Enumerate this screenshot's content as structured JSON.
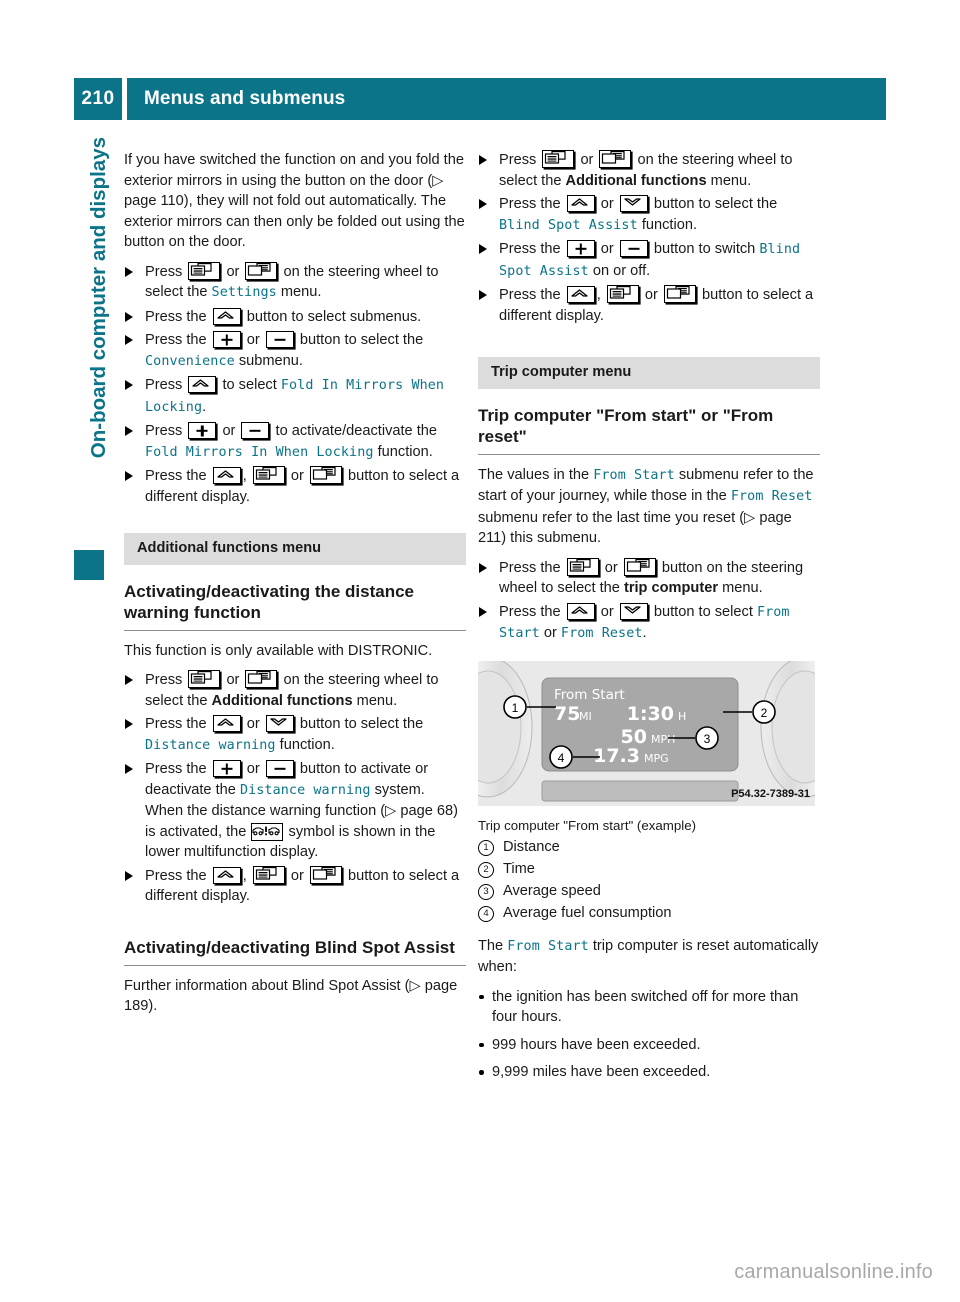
{
  "header": {
    "page_number": "210",
    "title": "Menus and submenus",
    "accent_color": "#0b7489"
  },
  "sidetab": {
    "chapter": "On-board computer and displays"
  },
  "left_column": {
    "intro_paragraph": "If you have switched the function on and you fold the exterior mirrors in using the button on the door (▷ page 110), they will not fold out automatically. The exterior mirrors can then only be folded out using the button on the door.",
    "steps": [
      {
        "pre": "Press",
        "icons": [
          "display-left-icon",
          "display-right-icon"
        ],
        "joiner": "or",
        "mid": "on the steering wheel to select the",
        "mono": "Settings",
        "post": "menu."
      },
      {
        "pre": "Press the",
        "icons": [
          "chevron-up-icon"
        ],
        "post": "button to select submenus."
      },
      {
        "pre": "Press the",
        "icons": [
          "plus-icon",
          "minus-icon"
        ],
        "joiner": "or",
        "mid": "button to select the",
        "mono": "Convenience",
        "post": "submenu."
      },
      {
        "pre": "Press",
        "icons": [
          "chevron-up-icon"
        ],
        "mid": "to select",
        "mono": "Fold In Mirrors When Locking",
        "post": "."
      },
      {
        "pre": "Press",
        "icons": [
          "plus-icon",
          "minus-icon"
        ],
        "joiner": "or",
        "mid": "to activate/deactivate the",
        "mono": "Fold Mirrors In When Locking",
        "post": "function."
      },
      {
        "pre": "Press the",
        "icons": [
          "chevron-up-icon",
          "display-left-icon",
          "display-right-icon"
        ],
        "post": "button to select a different display."
      }
    ],
    "band_heading": "Additional functions menu",
    "subhead_distance": "Activating/deactivating the distance warning function",
    "distance_intro": "This function is only available with DISTRONIC.",
    "distance_steps": [
      {
        "pre": "Press",
        "icons": [
          "display-left-icon",
          "display-right-icon"
        ],
        "joiner": "or",
        "mid": "on the steering wheel to select the",
        "bold": "Additional functions",
        "post": "menu."
      },
      {
        "pre": "Press the",
        "icons": [
          "chevron-up-icon",
          "chevron-down-icon"
        ],
        "joiner": "or",
        "mid": "button to select the",
        "mono": "Distance warning",
        "post": "function."
      },
      {
        "pre": "Press the",
        "icons": [
          "plus-icon",
          "minus-icon"
        ],
        "joiner": "or",
        "mid": "button to activate or deactivate the",
        "mono": "Distance warning",
        "post": "system.",
        "extra_pre": "When the distance warning function (▷ page 68) is activated, the",
        "extra_icon": "distance-warning-symbol",
        "extra_post": "symbol is shown in the lower multifunction display."
      },
      {
        "pre": "Press the",
        "icons": [
          "chevron-up-icon",
          "display-left-icon",
          "display-right-icon"
        ],
        "post": "button to select a different display."
      }
    ],
    "subhead_blindspot": "Activating/deactivating Blind Spot Assist",
    "blindspot_intro": "Further information about Blind Spot Assist (▷ page 189)."
  },
  "right_column": {
    "blindspot_steps": [
      {
        "pre": "Press",
        "icons": [
          "display-left-icon",
          "display-right-icon"
        ],
        "joiner": "or",
        "mid": "on the steering wheel to select the",
        "bold": "Additional functions",
        "post": "menu."
      },
      {
        "pre": "Press the",
        "icons": [
          "chevron-up-icon",
          "chevron-down-icon"
        ],
        "joiner": "or",
        "mid": "button to select the",
        "mono": "Blind Spot Assist",
        "post": "function."
      },
      {
        "pre": "Press the",
        "icons": [
          "plus-icon",
          "minus-icon"
        ],
        "joiner": "or",
        "mid": "button to switch",
        "mono": "Blind Spot Assist",
        "post": "on or off."
      },
      {
        "pre": "Press the",
        "icons": [
          "chevron-up-icon",
          "display-left-icon",
          "display-right-icon"
        ],
        "post": "button to select a different display."
      }
    ],
    "band_heading": "Trip computer menu",
    "subhead_trip": "Trip computer \"From start\" or \"From reset\"",
    "trip_intro_1": "The values in the ",
    "trip_mono_1": "From Start",
    "trip_intro_2": " submenu refer to the start of your journey, while those in the ",
    "trip_mono_2": "From Reset",
    "trip_intro_3": " submenu refer to the last time you reset (▷ page 211) this submenu.",
    "trip_steps": [
      {
        "pre": "Press the",
        "icons": [
          "display-left-icon",
          "display-right-icon"
        ],
        "joiner": "or",
        "mid": "button on the steering wheel to select the",
        "bold": "trip computer",
        "post": "menu."
      },
      {
        "pre": "Press the",
        "icons": [
          "chevron-up-icon",
          "chevron-down-icon"
        ],
        "joiner": "or",
        "mid": "button to select",
        "mono": "From Start",
        "mid2": "or",
        "mono2": "From Reset",
        "post": "."
      }
    ],
    "figure": {
      "display_title": "From Start",
      "distance": "75",
      "distance_unit": "MI",
      "time": "1:30",
      "time_unit": "H",
      "speed": "50",
      "speed_unit": "MPH",
      "consumption": "17.3",
      "consumption_unit": "MPG",
      "part_code": "P54.32-7389-31",
      "callouts": [
        "1",
        "2",
        "3",
        "4"
      ]
    },
    "figure_caption": "Trip computer \"From start\" (example)",
    "callout_list": [
      {
        "num": "1",
        "label": "Distance"
      },
      {
        "num": "2",
        "label": "Time"
      },
      {
        "num": "3",
        "label": "Average speed"
      },
      {
        "num": "4",
        "label": "Average fuel consumption"
      }
    ],
    "reset_intro_pre": "The ",
    "reset_intro_mono": "From Start",
    "reset_intro_post": " trip computer is reset automatically when:",
    "reset_bullets": [
      "the ignition has been switched off for more than four hours.",
      "999 hours have been exceeded.",
      "9,999 miles have been exceeded."
    ]
  },
  "footer": {
    "watermark": "carmanualsonline.info"
  }
}
